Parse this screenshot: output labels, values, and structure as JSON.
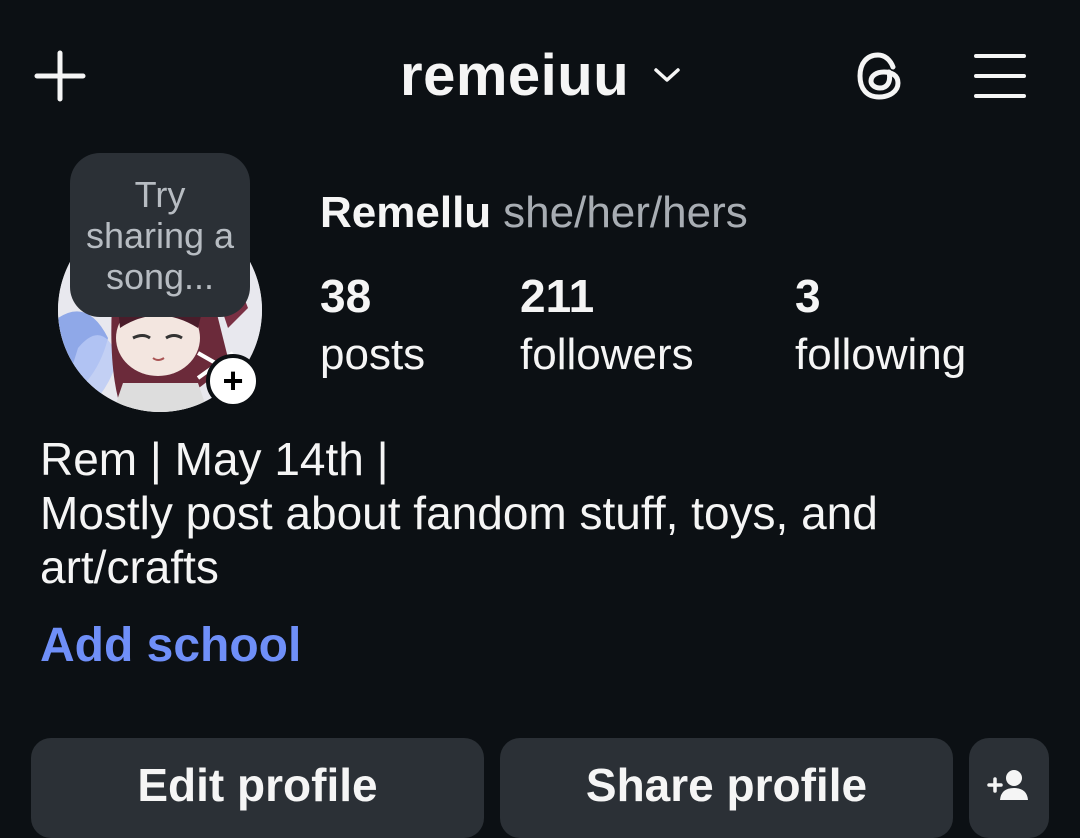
{
  "header": {
    "username": "remeiuu",
    "icons": [
      "plus-icon",
      "chevron-down-icon",
      "threads-icon",
      "hamburger-menu-icon"
    ]
  },
  "avatar": {
    "note_placeholder": "Try sharing a song..."
  },
  "profile": {
    "display_name": "Remellu",
    "pronouns": "she/her/hers"
  },
  "stats": [
    {
      "value": "38",
      "label": "posts"
    },
    {
      "value": "211",
      "label": "followers"
    },
    {
      "value": "3",
      "label": "following"
    }
  ],
  "bio": {
    "line1": "Rem | May 14th |",
    "line2": "Mostly post about fandom stuff, toys, and art/crafts"
  },
  "add_school": "Add school",
  "actions": {
    "edit_profile": "Edit profile",
    "share_profile": "Share profile",
    "suggest_icon": "add-person-icon"
  },
  "colors": {
    "background": "#0c1014",
    "button_bg": "#2b3036",
    "link": "#6f8ff8",
    "muted_text": "#a8adb3"
  }
}
